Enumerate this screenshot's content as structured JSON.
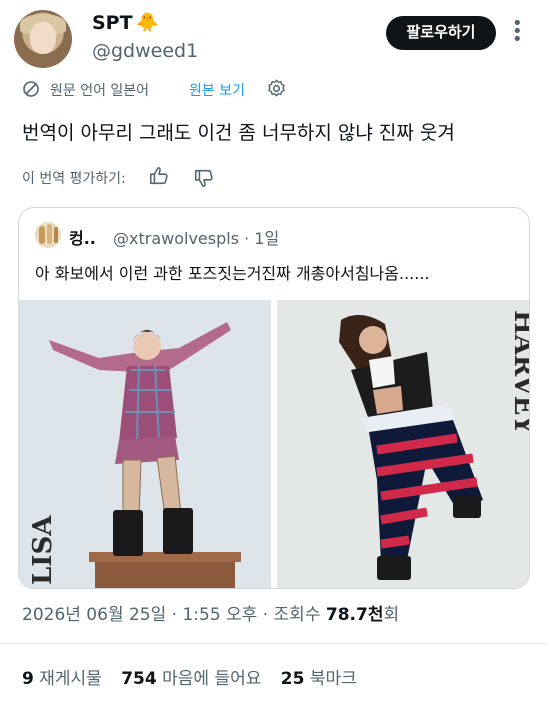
{
  "user": {
    "name": "SPT",
    "emoji": "🐥",
    "handle": "@gdweed1"
  },
  "follow_label": "팔로우하기",
  "translation": {
    "note": "원문 언어 일본어",
    "show_original": "원본 보기"
  },
  "tweet_text": "번역이 아무리 그래도 이건 좀 너무하지 않냐 진짜 웃겨",
  "rate_translation": "이 번역 평가하기:",
  "quote": {
    "name": "컹..",
    "handle_time": "@xtrawolvespls · 1일",
    "text": "아 화보에서 이런 과한 포즈짓는거진짜 개총아서침나옴......",
    "left_photo_text": "LISA",
    "right_photo_text": "HARVEY"
  },
  "meta": {
    "date_time": "2026년 06월 25일 · 1:55 오후 · 조회수 ",
    "views": "78.7천",
    "views_suffix": "회"
  },
  "stats": {
    "reposts_count": "9",
    "reposts_label": "재게시물",
    "likes_count": "754",
    "likes_label": "마음에 들어요",
    "bookmarks_count": "25",
    "bookmarks_label": "북마크"
  },
  "colors": {
    "accent": "#1d9bf0",
    "secondary_text": "#536471",
    "follow_button": "#0f1419"
  },
  "icons": [
    "translate-ban-icon",
    "gear-icon",
    "thumbs-up-icon",
    "thumbs-down-icon",
    "more-icon"
  ]
}
